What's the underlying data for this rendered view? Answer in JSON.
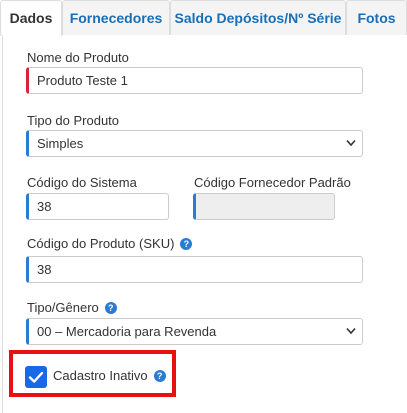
{
  "tabs": [
    {
      "label": "Dados",
      "active": true
    },
    {
      "label": "Fornecedores",
      "active": false
    },
    {
      "label": "Saldo Depósitos/Nº Série",
      "active": false
    },
    {
      "label": "Fotos",
      "active": false
    }
  ],
  "form": {
    "nome": {
      "label": "Nome do Produto",
      "value": "Produto Teste 1"
    },
    "tipo": {
      "label": "Tipo do Produto",
      "value": "Simples"
    },
    "codigo_sistema": {
      "label": "Código do Sistema",
      "value": "38"
    },
    "codigo_fornecedor": {
      "label": "Código Fornecedor Padrão",
      "value": ""
    },
    "codigo_sku": {
      "label": "Código do Produto (SKU)",
      "value": "38"
    },
    "tipo_genero": {
      "label": "Tipo/Gênero",
      "value": "00 – Mercadoria para Revenda"
    },
    "cadastro_inativo": {
      "label": "Cadastro Inativo",
      "checked": true
    }
  },
  "icons": {
    "help": "?"
  },
  "colors": {
    "link_blue": "#1a6eb6",
    "accent_blue": "#2a7bd3",
    "required_red": "#d9233a",
    "checkbox_blue": "#1769e8",
    "highlight_red": "#e81010"
  }
}
